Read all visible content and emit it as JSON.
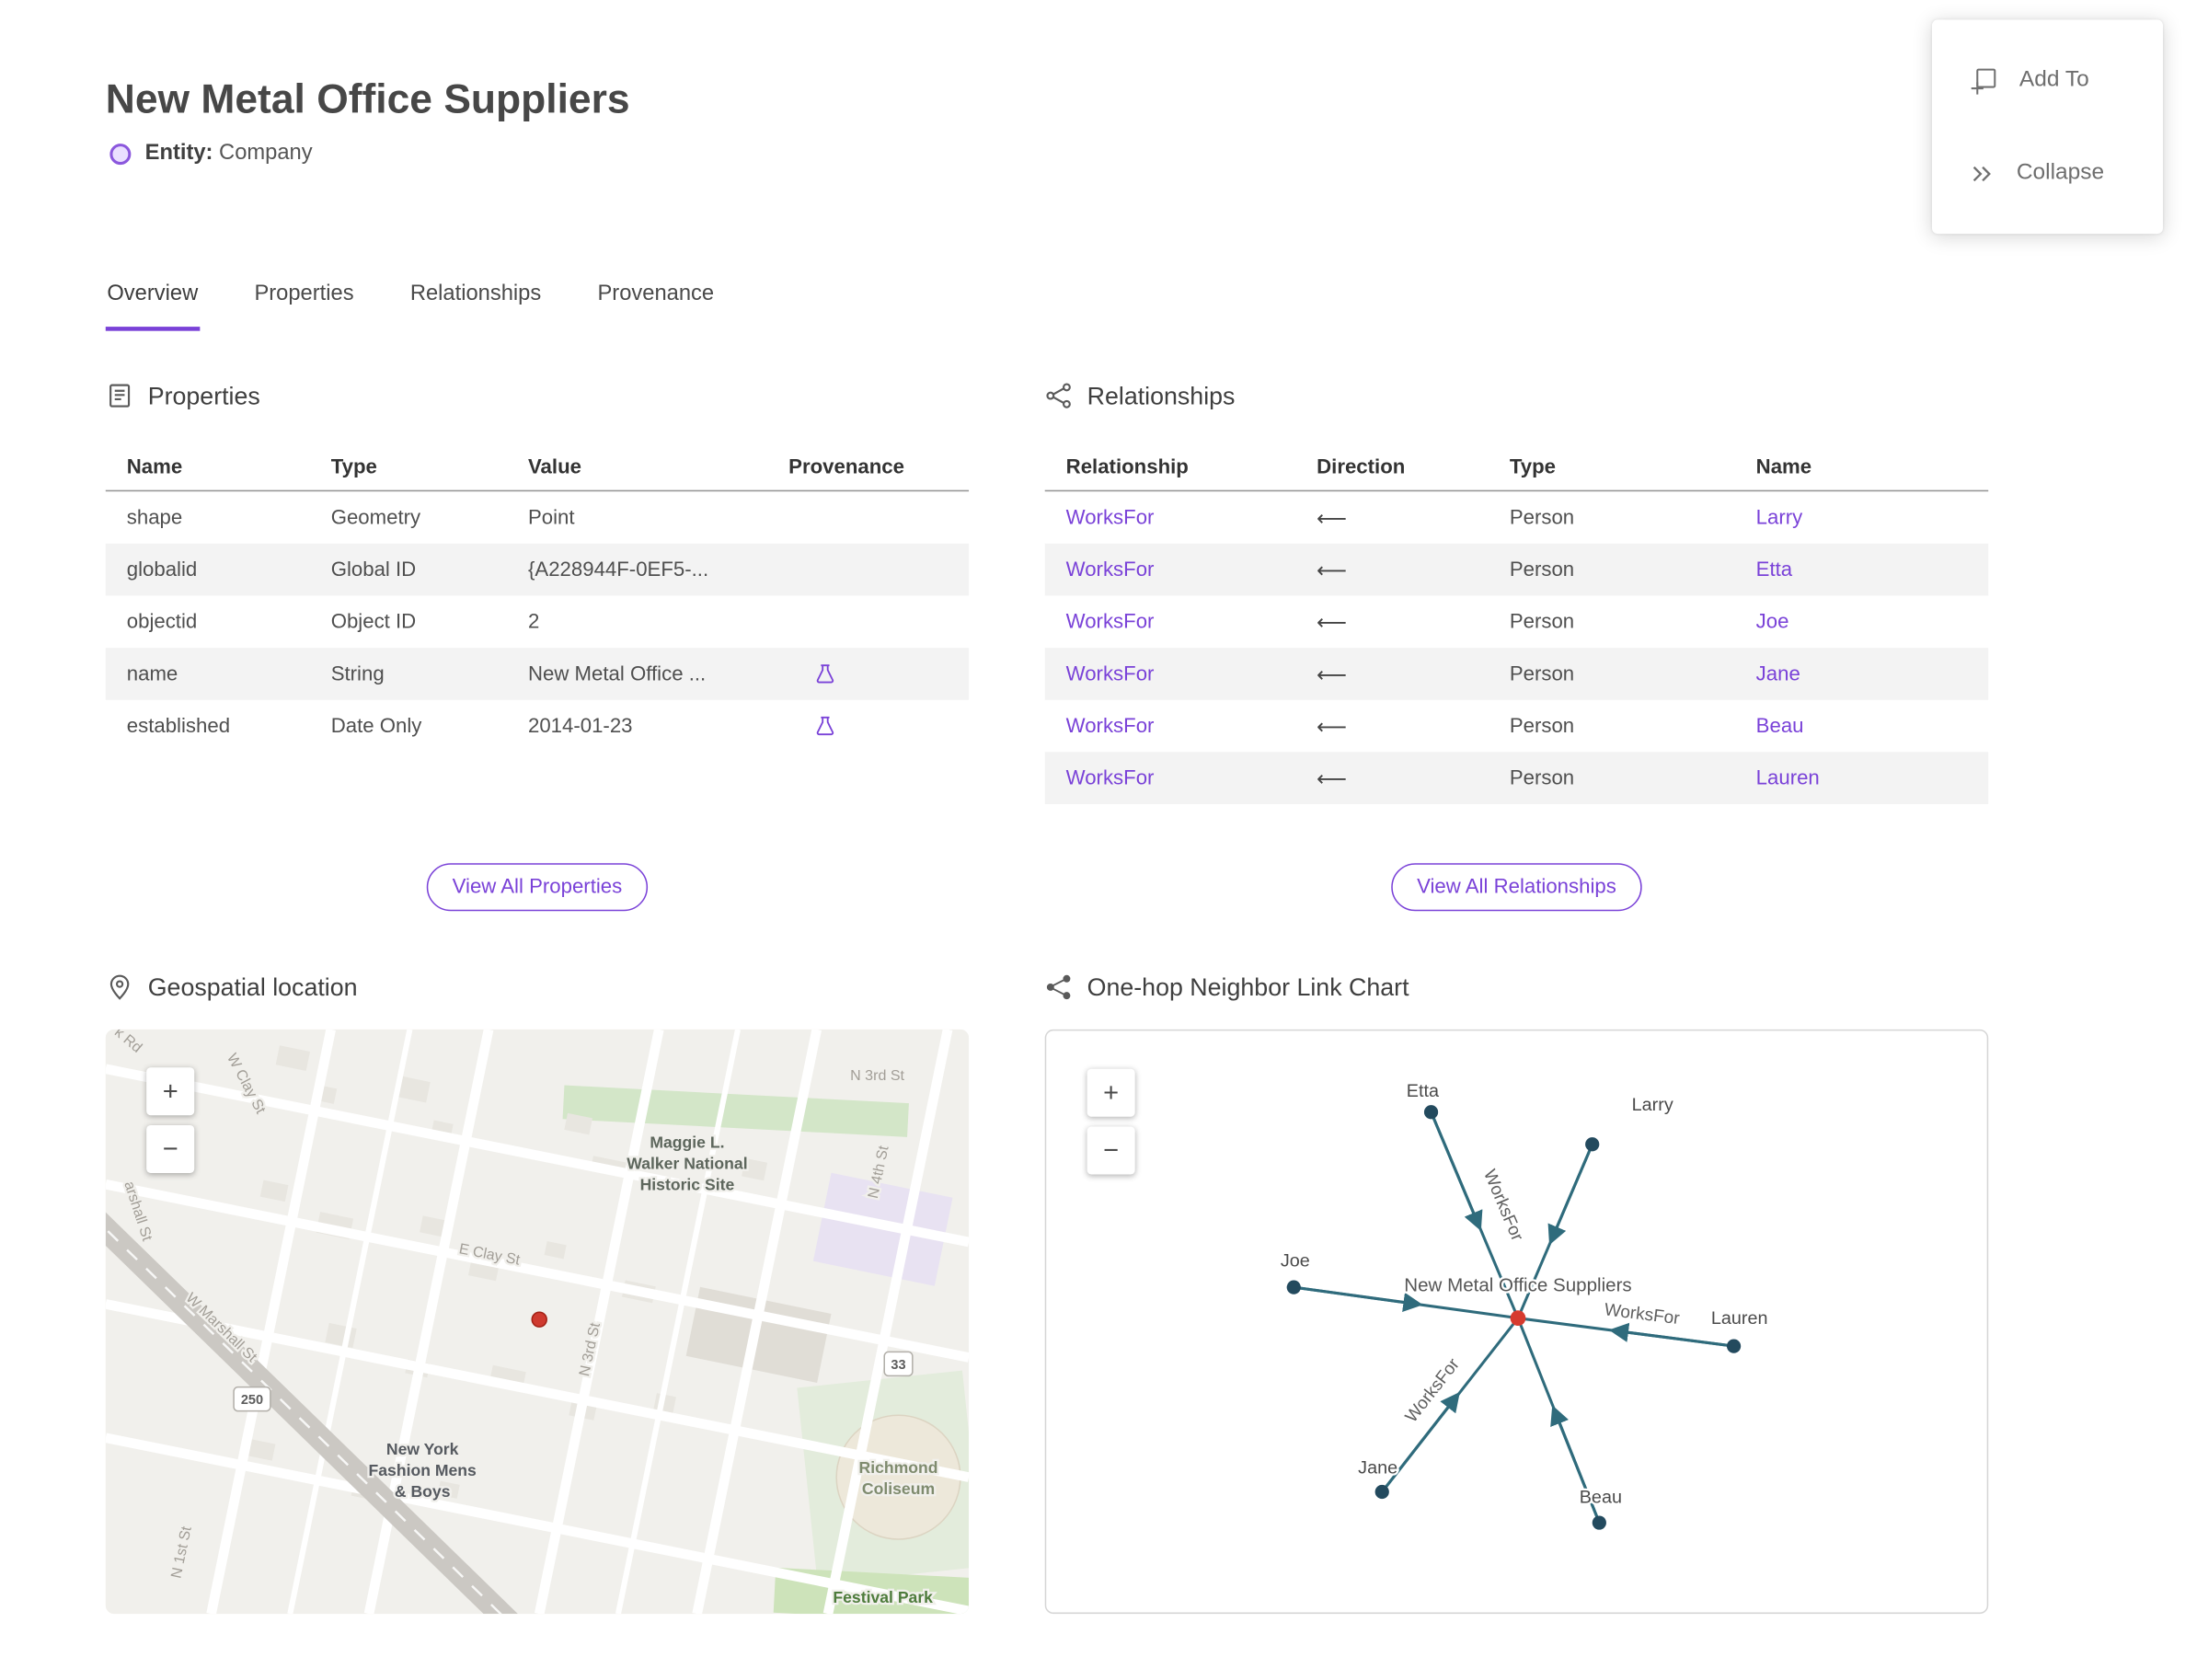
{
  "colors": {
    "accent": "#7a42d8",
    "edge": "#2f6b7c",
    "node": "#234a5e",
    "center-node": "#d63b2f",
    "marker-red": "#cf3a2f"
  },
  "header": {
    "title": "New Metal Office Suppliers",
    "entity_label": "Entity:",
    "entity_type": "Company"
  },
  "actions": {
    "add_to": "Add To",
    "collapse": "Collapse"
  },
  "tabs": {
    "overview": "Overview",
    "properties": "Properties",
    "relationships": "Relationships",
    "provenance": "Provenance"
  },
  "properties": {
    "heading": "Properties",
    "columns": {
      "name": "Name",
      "type": "Type",
      "value": "Value",
      "provenance": "Provenance"
    },
    "rows": [
      {
        "name": "shape",
        "type": "Geometry",
        "value": "Point",
        "provenance": false
      },
      {
        "name": "globalid",
        "type": "Global ID",
        "value": "{A228944F-0EF5-...",
        "provenance": false
      },
      {
        "name": "objectid",
        "type": "Object ID",
        "value": "2",
        "provenance": false
      },
      {
        "name": "name",
        "type": "String",
        "value": "New Metal Office ...",
        "provenance": true
      },
      {
        "name": "established",
        "type": "Date Only",
        "value": "2014-01-23",
        "provenance": true
      }
    ],
    "view_all": "View All Properties"
  },
  "relationships": {
    "heading": "Relationships",
    "columns": {
      "relationship": "Relationship",
      "direction": "Direction",
      "type": "Type",
      "name": "Name"
    },
    "rows": [
      {
        "relationship": "WorksFor",
        "direction": "⟵",
        "type": "Person",
        "name": "Larry"
      },
      {
        "relationship": "WorksFor",
        "direction": "⟵",
        "type": "Person",
        "name": "Etta"
      },
      {
        "relationship": "WorksFor",
        "direction": "⟵",
        "type": "Person",
        "name": "Joe"
      },
      {
        "relationship": "WorksFor",
        "direction": "⟵",
        "type": "Person",
        "name": "Jane"
      },
      {
        "relationship": "WorksFor",
        "direction": "⟵",
        "type": "Person",
        "name": "Beau"
      },
      {
        "relationship": "WorksFor",
        "direction": "⟵",
        "type": "Person",
        "name": "Lauren"
      }
    ],
    "view_all": "View All Relationships"
  },
  "map": {
    "heading": "Geospatial location",
    "zoom_in": "+",
    "zoom_out": "−",
    "streets": {
      "n3rd_top": "N 3rd St",
      "n4th": "N 4th St",
      "n3rd": "N 3rd St",
      "e_clay": "E Clay St",
      "w_clay": "W Clay St",
      "w_marshall": "W Marshall St",
      "marshall": "arshall St",
      "n1st": "N 1st St",
      "k_rd": "k Rd"
    },
    "pois": {
      "maggie_1": "Maggie L.",
      "maggie_2": "Walker National",
      "maggie_3": "Historic Site",
      "fashion_1": "New York",
      "fashion_2": "Fashion Mens",
      "fashion_3": "& Boys",
      "coliseum_1": "Richmond",
      "coliseum_2": "Coliseum",
      "festival": "Festival Park"
    },
    "shields": {
      "us250": "250",
      "sr33": "33"
    }
  },
  "link_chart": {
    "heading": "One-hop Neighbor Link Chart",
    "zoom_in": "+",
    "zoom_out": "−",
    "center_label": "New Metal Office Suppliers",
    "edge_label": "WorksFor",
    "nodes": [
      {
        "name": "Etta"
      },
      {
        "name": "Larry"
      },
      {
        "name": "Joe"
      },
      {
        "name": "Lauren"
      },
      {
        "name": "Jane"
      },
      {
        "name": "Beau"
      }
    ]
  }
}
